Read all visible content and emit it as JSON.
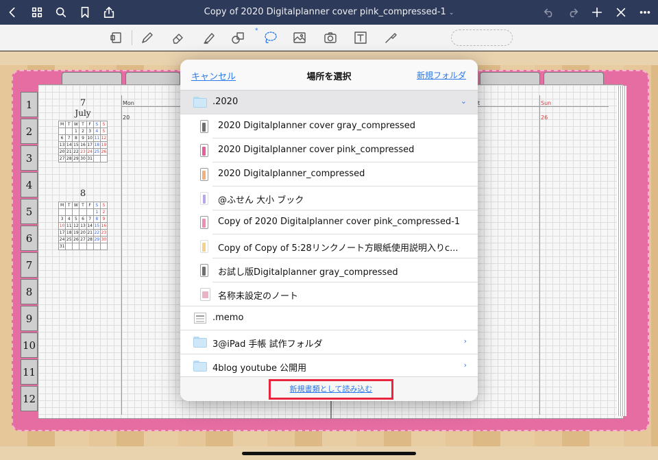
{
  "topbar": {
    "title": "Copy of 2020 Digitalplanner cover pink_compressed-1",
    "title_chevron": "⌄"
  },
  "toolbar": {
    "bluetooth": "*"
  },
  "planner": {
    "side_tabs": [
      "1",
      "2",
      "3",
      "4",
      "5",
      "6",
      "7",
      "8",
      "9",
      "10",
      "11",
      "12"
    ],
    "month1": {
      "num": "7",
      "name": "July",
      "head": [
        "M",
        "T",
        "W",
        "T",
        "F",
        "S",
        "S"
      ],
      "weeks": [
        [
          "",
          "",
          "1",
          "2",
          "3",
          "4",
          "5"
        ],
        [
          "6",
          "7",
          "8",
          "9",
          "10",
          "11",
          "12"
        ],
        [
          "13",
          "14",
          "15",
          "16",
          "17",
          "18",
          "19"
        ],
        [
          "20",
          "21",
          "22",
          "23",
          "24",
          "25",
          "26"
        ],
        [
          "27",
          "28",
          "29",
          "30",
          "31",
          "",
          ""
        ]
      ]
    },
    "month2": {
      "num": "8",
      "head": [
        "M",
        "T",
        "W",
        "T",
        "F",
        "S",
        "S"
      ],
      "weeks": [
        [
          "",
          "",
          "",
          "",
          "",
          "1",
          "2"
        ],
        [
          "3",
          "4",
          "5",
          "6",
          "7",
          "8",
          "9"
        ],
        [
          "10",
          "11",
          "12",
          "13",
          "14",
          "15",
          "16"
        ],
        [
          "17",
          "18",
          "19",
          "20",
          "21",
          "22",
          "23"
        ],
        [
          "24",
          "25",
          "26",
          "27",
          "28",
          "29",
          "30"
        ],
        [
          "31",
          "",
          "",
          "",
          "",
          "",
          ""
        ]
      ]
    },
    "mon_label": "Mon",
    "mon_date": "20",
    "sat_label": "t",
    "sun_label": "Sun",
    "sun_date": "26"
  },
  "modal": {
    "cancel": "キャンセル",
    "title": "場所を選択",
    "new_folder": "新規フォルダ",
    "rows": [
      {
        "type": "folder",
        "label": ".2020",
        "arrow": "⌄",
        "selected": true
      },
      {
        "type": "notebook",
        "label": "2020 Digitalplanner cover gray_compressed",
        "color": "#6f6f6f"
      },
      {
        "type": "notebook",
        "label": "2020 Digitalplanner cover pink_compressed",
        "color": "#e35e9a"
      },
      {
        "type": "notebook",
        "label": "2020 Digitalplanner_compressed",
        "color": "#f0b27a"
      },
      {
        "type": "notebook",
        "label": "@ふせん 大小 ブック",
        "color": "#b9a6e8"
      },
      {
        "type": "notebook",
        "label": "Copy of 2020 Digitalplanner cover pink_compressed-1",
        "color": "#f08cb5"
      },
      {
        "type": "notebook",
        "label": "Copy of Copy of 5:28リンクノート方眼紙使用説明入りc...",
        "color": "#f3d38a"
      },
      {
        "type": "notebook",
        "label": "お試し版Digitalplanner gray_compressed",
        "color": "#6f6f6f"
      },
      {
        "type": "notebook",
        "label": "名称未設定のノート",
        "color": "#e9b3c8"
      },
      {
        "type": "memo",
        "label": ".memo"
      },
      {
        "type": "folder",
        "label": "3@iPad 手帳 試作フォルダ",
        "arrow": "›"
      },
      {
        "type": "folder",
        "label": "4blog youtube 公開用",
        "arrow": "›"
      }
    ],
    "import_label": "新規書類として読み込む"
  }
}
